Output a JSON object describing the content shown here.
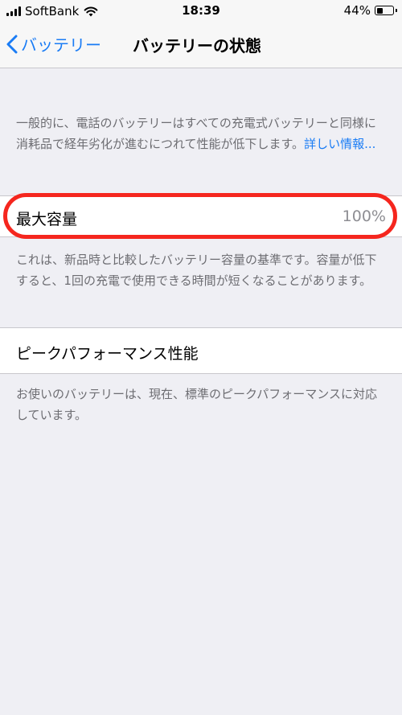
{
  "status_bar": {
    "carrier": "SoftBank",
    "time": "18:39",
    "battery_percent_label": "44%",
    "battery_level": 0.44,
    "signal_bars": 4
  },
  "nav": {
    "back_label": "バッテリー",
    "title": "バッテリーの状態"
  },
  "intro": {
    "text": "一般的に、電話のバッテリーはすべての充電式バッテリーと同様に消耗品で経年劣化が進むにつれて性能が低下します。",
    "link": "詳しい情報..."
  },
  "max_capacity": {
    "label": "最大容量",
    "value": "100%",
    "note": "これは、新品時と比較したバッテリー容量の基準です。容量が低下すると、1回の充電で使用できる時間が短くなることがあります。"
  },
  "peak_performance": {
    "label": "ピークパフォーマンス性能",
    "note": "お使いのバッテリーは、現在、標準のピークパフォーマンスに対応しています。"
  },
  "colors": {
    "accent": "#1a7cf5",
    "highlight": "#f5261e",
    "background": "#efeff4"
  }
}
